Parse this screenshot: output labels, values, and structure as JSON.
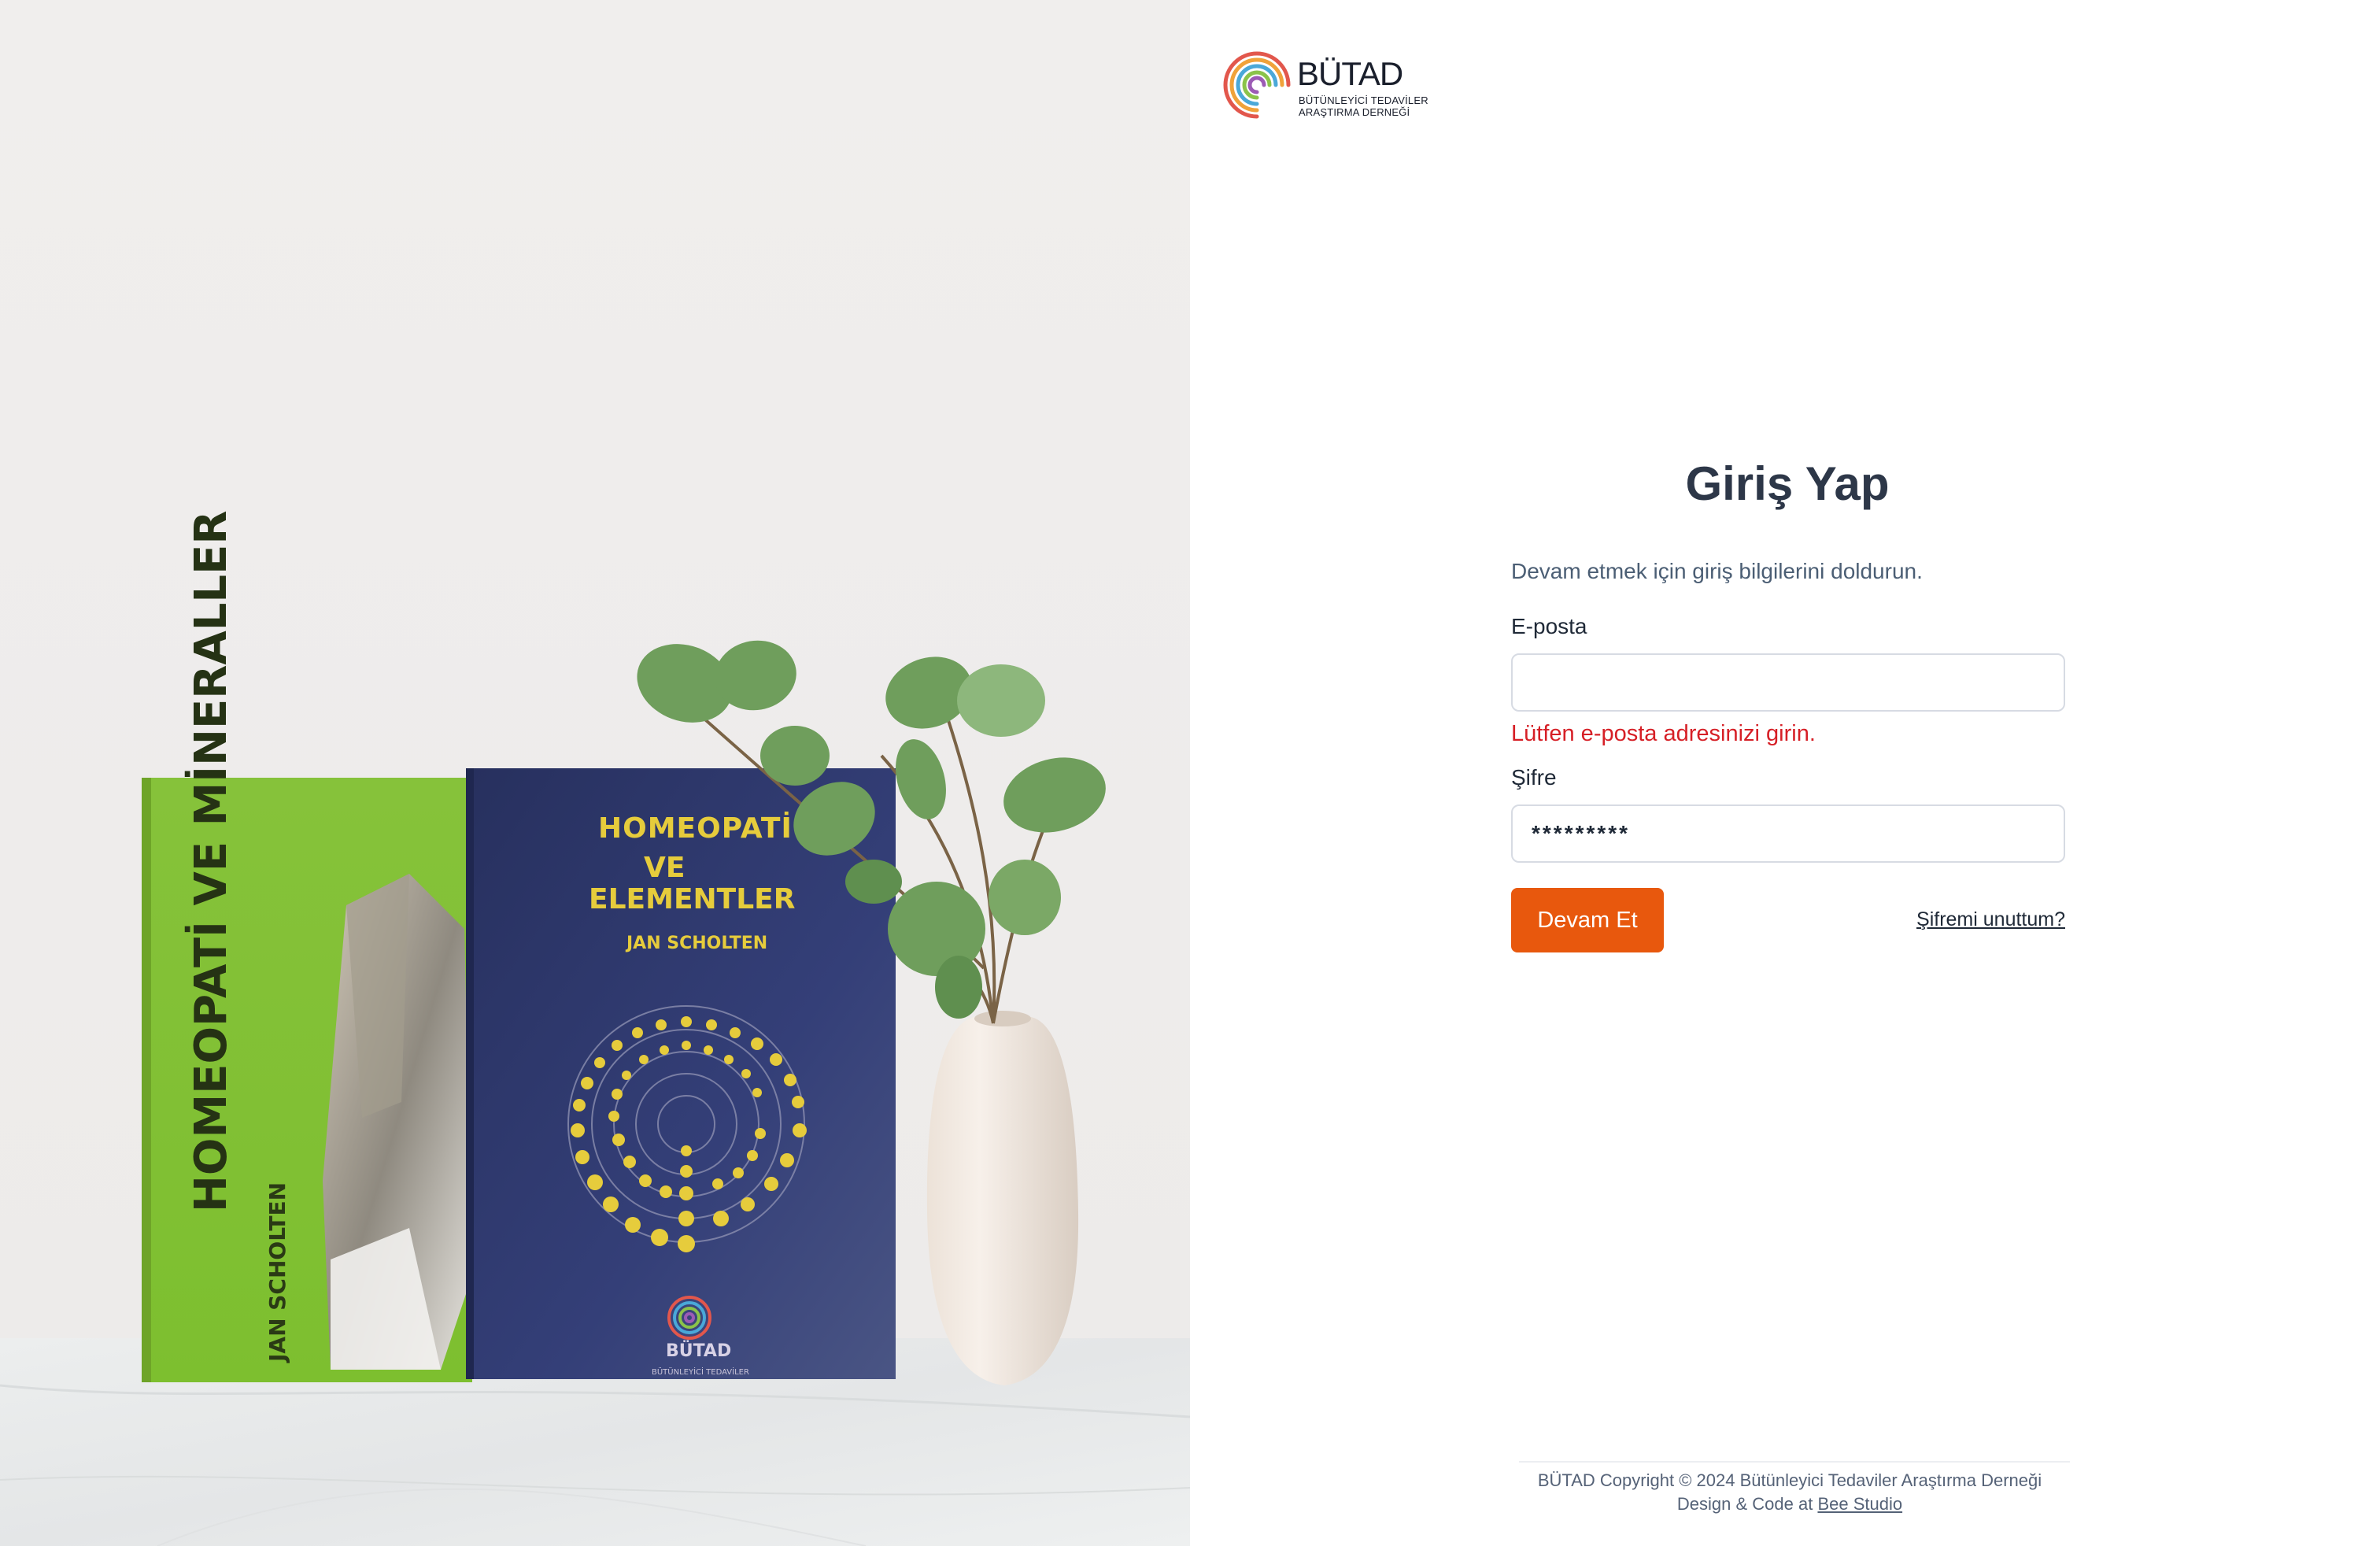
{
  "brand": {
    "name": "BÜTAD",
    "subtitle_line1": "BÜTÜNLEYİCİ TEDAVİLER",
    "subtitle_line2": "ARAŞTIRMA DERNEĞİ"
  },
  "hero": {
    "book_green_title": "HOMEOPATİ VE MİNERALLER",
    "book_green_author": "JAN SCHOLTEN",
    "book_blue_title_1": "HOMEOPATİ",
    "book_blue_title_2": "VE",
    "book_blue_title_3": "ELEMENTLER",
    "book_blue_author": "JAN SCHOLTEN",
    "book_blue_logo": "BÜTAD",
    "book_blue_logo_sub": "BÜTÜNLEYİCİ TEDAVİLER"
  },
  "login": {
    "title": "Giriş Yap",
    "subtitle": "Devam etmek için giriş bilgilerini doldurun.",
    "email_label": "E-posta",
    "email_value": "",
    "email_error": "Lütfen e-posta adresinizi girin.",
    "password_label": "Şifre",
    "password_value": "*********",
    "submit_label": "Devam Et",
    "forgot_label": "Şifremi unuttum?"
  },
  "footer": {
    "copyright_prefix": "BÜTAD Copyright",
    "copyright_symbol": "©",
    "copyright_text": "2024 Bütünleyici Tedaviler Araştırma Derneği",
    "credit_prefix": "Design & Code at",
    "credit_link": "Bee Studio"
  },
  "colors": {
    "accent": "#e8580d",
    "error": "#d61f26",
    "title": "#2d3748",
    "muted": "#4b5e74"
  }
}
